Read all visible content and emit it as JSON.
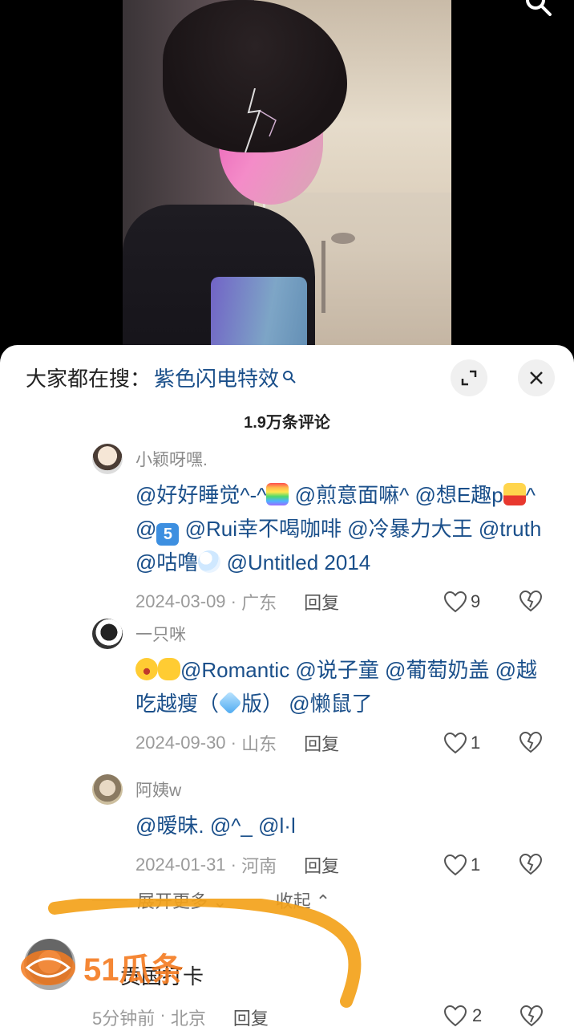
{
  "search_bar": {
    "prefix": "大家都在搜：",
    "term": "紫色闪电特效"
  },
  "comment_count": "1.9万条评论",
  "comments": [
    {
      "username": "小颖呀嘿.",
      "text_parts": [
        "@好好睡觉^-^",
        "🌈",
        " @煎意面嘛^ @想E趣p",
        "🍟",
        "^ @",
        "5️⃣",
        " @Rui幸不喝咖啡 @冷暴力大王 @truth @咕噜",
        "🫧",
        " @Untitled 2014"
      ],
      "date": "2024-03-09",
      "location": "广东",
      "reply_label": "回复",
      "likes": "9"
    },
    {
      "username": "一只咪",
      "text_parts": [
        "😂",
        "👌",
        "@Romantic @说子童 @葡萄奶盖 @越吃越瘦（",
        "💎",
        "版） @懒鼠了"
      ],
      "date": "2024-09-30",
      "location": "山东",
      "reply_label": "回复",
      "likes": "1"
    },
    {
      "username": "阿姨w",
      "text_parts": [
        "@暧昧. @^_ @l·l"
      ],
      "date": "2024-01-31",
      "location": "河南",
      "reply_label": "回复",
      "likes": "1"
    }
  ],
  "expand_more": "展开更多",
  "collapse": "收起",
  "last_comment": {
    "text": "贡国打卡",
    "time": "5分钟前",
    "location": "北京",
    "reply_label": "回复",
    "likes": "2"
  },
  "watermark": "51瓜条",
  "colors": {
    "link": "#1a4f8a",
    "muted": "#9a9a9a",
    "brush": "#f3a21a"
  }
}
